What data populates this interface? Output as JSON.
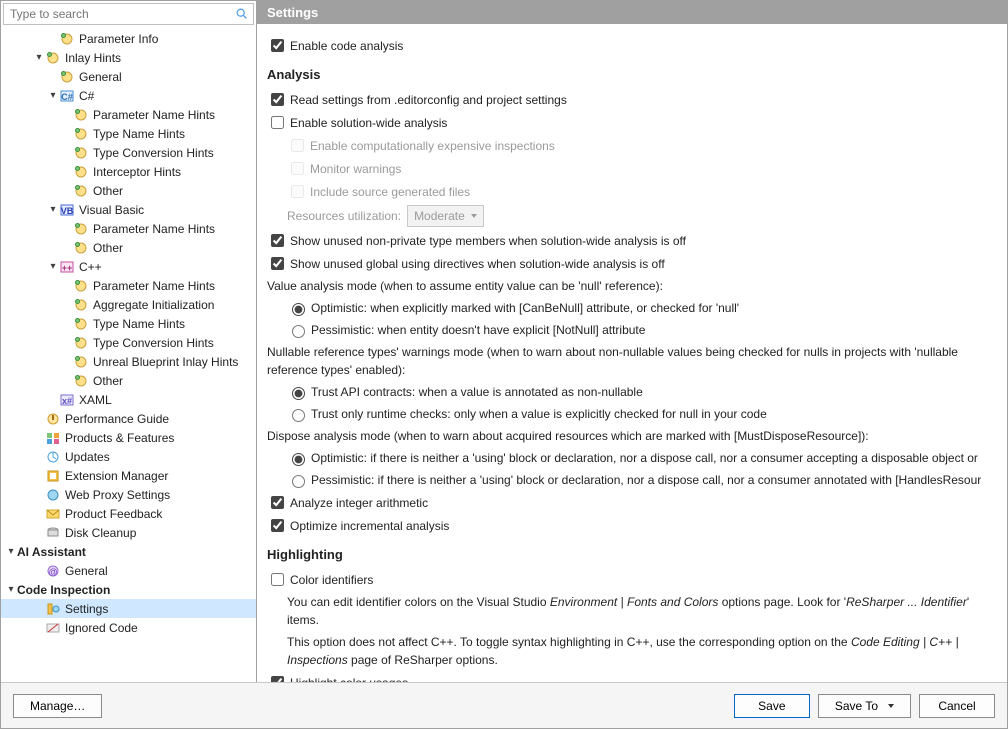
{
  "search": {
    "placeholder": "Type to search"
  },
  "sidebar": {
    "items": [
      {
        "label": "Parameter Info",
        "indent": 3,
        "arrow": "",
        "icon": "hint",
        "name": "tree-parameter-info"
      },
      {
        "label": "Inlay Hints",
        "indent": 2,
        "arrow": "▾",
        "icon": "hint",
        "name": "tree-inlay-hints"
      },
      {
        "label": "General",
        "indent": 3,
        "arrow": "",
        "icon": "hint",
        "name": "tree-general"
      },
      {
        "label": "C#",
        "indent": 3,
        "arrow": "▾",
        "icon": "csharp",
        "name": "tree-csharp"
      },
      {
        "label": "Parameter Name Hints",
        "indent": 4,
        "arrow": "",
        "icon": "hint",
        "name": "tree-cs-param-name"
      },
      {
        "label": "Type Name Hints",
        "indent": 4,
        "arrow": "",
        "icon": "hint",
        "name": "tree-cs-type-name"
      },
      {
        "label": "Type Conversion Hints",
        "indent": 4,
        "arrow": "",
        "icon": "hint",
        "name": "tree-cs-type-conv"
      },
      {
        "label": "Interceptor Hints",
        "indent": 4,
        "arrow": "",
        "icon": "hint",
        "name": "tree-cs-interceptor"
      },
      {
        "label": "Other",
        "indent": 4,
        "arrow": "",
        "icon": "hint",
        "name": "tree-cs-other"
      },
      {
        "label": "Visual Basic",
        "indent": 3,
        "arrow": "▾",
        "icon": "vb",
        "name": "tree-vb"
      },
      {
        "label": "Parameter Name Hints",
        "indent": 4,
        "arrow": "",
        "icon": "hint",
        "name": "tree-vb-param-name"
      },
      {
        "label": "Other",
        "indent": 4,
        "arrow": "",
        "icon": "hint",
        "name": "tree-vb-other"
      },
      {
        "label": "C++",
        "indent": 3,
        "arrow": "▾",
        "icon": "cpp",
        "name": "tree-cpp"
      },
      {
        "label": "Parameter Name Hints",
        "indent": 4,
        "arrow": "",
        "icon": "hint",
        "name": "tree-cpp-param-name"
      },
      {
        "label": "Aggregate Initialization",
        "indent": 4,
        "arrow": "",
        "icon": "hint",
        "name": "tree-cpp-agg-init"
      },
      {
        "label": "Type Name Hints",
        "indent": 4,
        "arrow": "",
        "icon": "hint",
        "name": "tree-cpp-type-name"
      },
      {
        "label": "Type Conversion Hints",
        "indent": 4,
        "arrow": "",
        "icon": "hint",
        "name": "tree-cpp-type-conv"
      },
      {
        "label": "Unreal Blueprint Inlay Hints",
        "indent": 4,
        "arrow": "",
        "icon": "hint",
        "name": "tree-cpp-unreal"
      },
      {
        "label": "Other",
        "indent": 4,
        "arrow": "",
        "icon": "hint",
        "name": "tree-cpp-other"
      },
      {
        "label": "XAML",
        "indent": 3,
        "arrow": "",
        "icon": "xaml",
        "name": "tree-xaml"
      },
      {
        "label": "Performance Guide",
        "indent": 2,
        "arrow": "",
        "icon": "perf",
        "name": "tree-perf-guide"
      },
      {
        "label": "Products & Features",
        "indent": 2,
        "arrow": "",
        "icon": "prod",
        "name": "tree-products"
      },
      {
        "label": "Updates",
        "indent": 2,
        "arrow": "",
        "icon": "update",
        "name": "tree-updates"
      },
      {
        "label": "Extension Manager",
        "indent": 2,
        "arrow": "",
        "icon": "ext",
        "name": "tree-ext-manager"
      },
      {
        "label": "Web Proxy Settings",
        "indent": 2,
        "arrow": "",
        "icon": "proxy",
        "name": "tree-web-proxy"
      },
      {
        "label": "Product Feedback",
        "indent": 2,
        "arrow": "",
        "icon": "mail",
        "name": "tree-feedback"
      },
      {
        "label": "Disk Cleanup",
        "indent": 2,
        "arrow": "",
        "icon": "disk",
        "name": "tree-disk-cleanup"
      },
      {
        "label": "AI Assistant",
        "indent": 0,
        "arrow": "▾",
        "icon": "",
        "name": "tree-ai-assistant",
        "bold": true
      },
      {
        "label": "General",
        "indent": 2,
        "arrow": "",
        "icon": "ai",
        "name": "tree-ai-general"
      },
      {
        "label": "Code Inspection",
        "indent": 0,
        "arrow": "▾",
        "icon": "",
        "name": "tree-code-inspection",
        "bold": true
      },
      {
        "label": "Settings",
        "indent": 2,
        "arrow": "",
        "icon": "set",
        "name": "tree-ci-settings",
        "selected": true
      },
      {
        "label": "Ignored Code",
        "indent": 2,
        "arrow": "",
        "icon": "ign",
        "name": "tree-ci-ignored"
      }
    ]
  },
  "main_title": "Settings",
  "settings": {
    "enable_code_analysis": {
      "label": "Enable code analysis",
      "checked": true
    },
    "analysis_heading": "Analysis",
    "read_editorconfig": {
      "label": "Read settings from .editorconfig and project settings",
      "checked": true
    },
    "enable_swa": {
      "label": "Enable solution-wide analysis",
      "checked": false
    },
    "enable_expensive": {
      "label": "Enable computationally expensive inspections",
      "checked": false,
      "disabled": true
    },
    "monitor_warnings": {
      "label": "Monitor warnings",
      "checked": false,
      "disabled": true
    },
    "include_generated": {
      "label": "Include source generated files",
      "checked": false,
      "disabled": true
    },
    "resources_label": "Resources utilization:",
    "resources_value": "Moderate",
    "show_unused_type": {
      "label": "Show unused non-private type members when solution-wide analysis is off",
      "checked": true
    },
    "show_unused_global": {
      "label": "Show unused global using directives when solution-wide analysis is off",
      "checked": true
    },
    "value_analysis_heading": "Value analysis mode (when to assume entity value can be 'null' reference):",
    "value_opt_optimistic": "Optimistic: when explicitly marked with [CanBeNull] attribute, or checked for 'null'",
    "value_opt_pessimistic": "Pessimistic: when entity doesn't have explicit [NotNull] attribute",
    "value_selected": "optimistic",
    "nrt_heading": "Nullable reference types' warnings mode (when to warn about non-nullable values being checked for nulls in projects with 'nullable reference types' enabled):",
    "nrt_opt_trust": "Trust API contracts: when a value is annotated as non-nullable",
    "nrt_opt_runtime": "Trust only runtime checks: only when a value is explicitly checked for null in your code",
    "nrt_selected": "trust",
    "dispose_heading": "Dispose analysis mode (when to warn about acquired resources which are marked with [MustDisposeResource]):",
    "dispose_opt_optimistic": "Optimistic: if there is neither a 'using' block or declaration, nor a dispose call, nor a consumer accepting a disposable object or",
    "dispose_opt_pessimistic": "Pessimistic: if there is neither a 'using' block or declaration, nor a dispose call, nor a consumer annotated with [HandlesResour",
    "dispose_selected": "optimistic",
    "analyze_int": {
      "label": "Analyze integer arithmetic",
      "checked": true
    },
    "optimize_inc": {
      "label": "Optimize incremental analysis",
      "checked": true
    },
    "highlight_heading": "Highlighting",
    "color_identifiers": {
      "label": "Color identifiers",
      "checked": false
    },
    "note1_a": "You can edit identifier colors on the Visual Studio ",
    "note1_b": "Environment | Fonts and Colors",
    "note1_c": " options page. Look for '",
    "note1_d": "ReSharper ... Identifier",
    "note1_e": "' items.",
    "note2_a": "This option does not affect C++. To toggle syntax highlighting in C++, use the corresponding option on the ",
    "note2_b": "Code Editing | C++ | Inspections",
    "note2_c": " page of ReSharper options.",
    "highlight_color": {
      "label": "Highlight color usages",
      "checked": true
    }
  },
  "buttons": {
    "manage": "Manage…",
    "save": "Save",
    "save_to": "Save To",
    "cancel": "Cancel"
  }
}
